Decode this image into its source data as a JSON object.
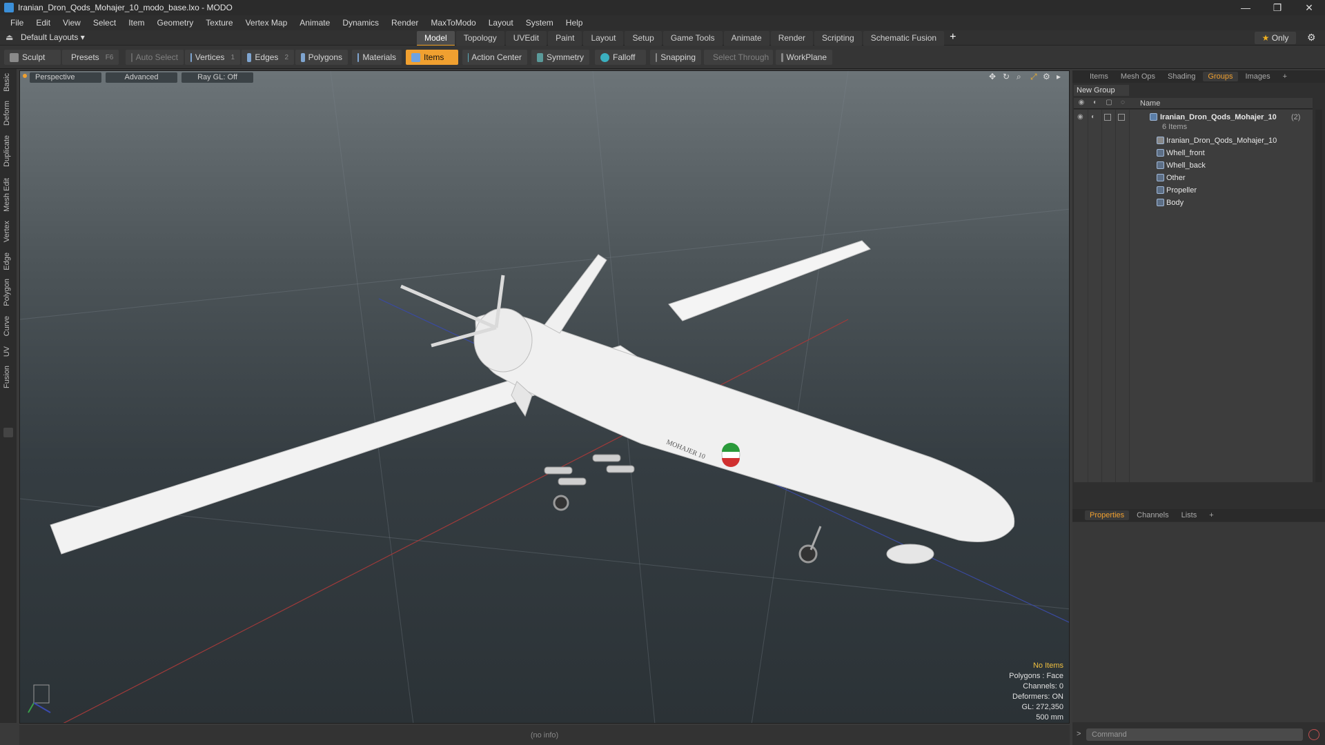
{
  "window": {
    "title": "Iranian_Dron_Qods_Mohajer_10_modo_base.lxo - MODO",
    "minimize": "—",
    "restore": "❐",
    "close": "✕"
  },
  "menu": [
    "File",
    "Edit",
    "View",
    "Select",
    "Item",
    "Geometry",
    "Texture",
    "Vertex Map",
    "Animate",
    "Dynamics",
    "Render",
    "MaxToModo",
    "Layout",
    "System",
    "Help"
  ],
  "layout": {
    "current": "Default Layouts ▾",
    "tabs": [
      "Model",
      "Topology",
      "UVEdit",
      "Paint",
      "Layout",
      "Setup",
      "Game Tools",
      "Animate",
      "Render",
      "Scripting",
      "Schematic Fusion"
    ],
    "active_tab": "Model",
    "only_label": "Only"
  },
  "toolbar": {
    "sculpt": "Sculpt",
    "presets": "Presets",
    "presets_key": "F6",
    "auto_select": "Auto Select",
    "vertices": "Vertices",
    "vertices_key": "1",
    "edges": "Edges",
    "edges_key": "2",
    "polygons": "Polygons",
    "materials": "Materials",
    "items": "Items",
    "action_center": "Action Center",
    "symmetry": "Symmetry",
    "falloff": "Falloff",
    "snapping": "Snapping",
    "select_through": "Select Through",
    "workplane": "WorkPlane"
  },
  "left_tabs": [
    "Basic",
    "Deform",
    "Duplicate",
    "Mesh Edit",
    "Vertex",
    "Edge",
    "Polygon",
    "Curve",
    "UV",
    "Fusion"
  ],
  "viewport": {
    "view": "Perspective",
    "shading": "Advanced",
    "raygl": "Ray GL: Off",
    "decal_text": "MOHAJER 10",
    "info": {
      "items": "No Items",
      "polygons": "Polygons : Face",
      "channels": "Channels: 0",
      "deformers": "Deformers: ON",
      "gl": "GL: 272,350",
      "scale": "500 mm"
    }
  },
  "status": {
    "text": "(no info)"
  },
  "right_panel": {
    "top_tabs": [
      "Items",
      "Mesh Ops",
      "Shading",
      "Groups",
      "Images"
    ],
    "active_top_tab": "Groups",
    "new_group": "New Group",
    "name_header": "Name",
    "group": {
      "name": "Iranian_Dron_Qods_Mohajer_10",
      "count": "(2)",
      "subtitle": "6 Items",
      "children": [
        "Iranian_Dron_Qods_Mohajer_10",
        "Whell_front",
        "Whell_back",
        "Other",
        "Propeller",
        "Body"
      ]
    },
    "bottom_tabs": [
      "Properties",
      "Channels",
      "Lists"
    ],
    "active_bottom_tab": "Properties",
    "command_placeholder": "Command",
    "command_prompt": ">"
  }
}
